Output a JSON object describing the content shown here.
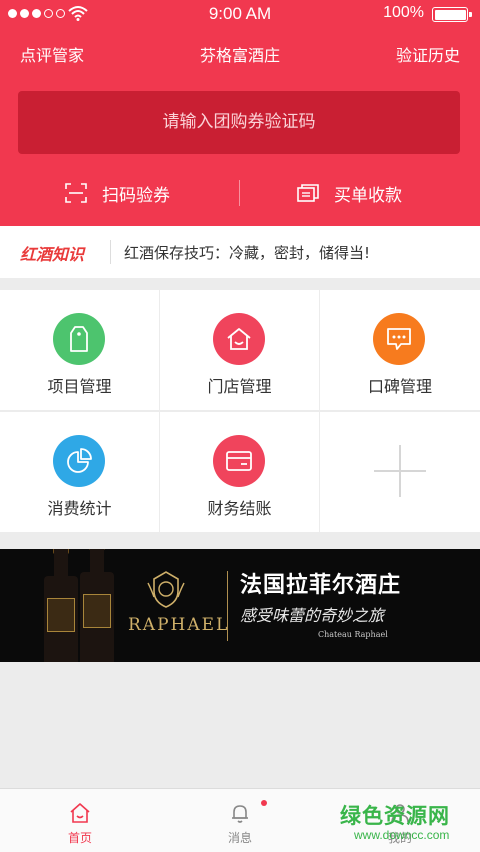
{
  "status_bar": {
    "time": "9:00 AM",
    "battery": "100%"
  },
  "nav": {
    "left": "点评管家",
    "title": "芬格富酒庄",
    "right": "验证历史"
  },
  "voucher_input": {
    "placeholder": "请输入团购券验证码"
  },
  "actions": {
    "scan": "扫码验券",
    "checkout": "买单收款"
  },
  "knowledge": {
    "label": "红酒知识",
    "text": "红酒保存技巧：冷藏，密封，储得当!"
  },
  "grid": {
    "items": [
      {
        "label": "项目管理",
        "color": "#4dc46e",
        "icon": "tag-icon"
      },
      {
        "label": "门店管理",
        "color": "#f0445c",
        "icon": "store-icon"
      },
      {
        "label": "口碑管理",
        "color": "#f77b1e",
        "icon": "chat-icon"
      },
      {
        "label": "消费统计",
        "color": "#2fa8e6",
        "icon": "pie-chart-icon"
      },
      {
        "label": "财务结账",
        "color": "#f0445c",
        "icon": "card-icon"
      }
    ]
  },
  "banner": {
    "brand": "RAPHAEL",
    "title": "法国拉菲尔酒庄",
    "subtitle": "感受味蕾的奇妙之旅",
    "small": "Chateau Raphael"
  },
  "tabbar": {
    "tabs": [
      {
        "label": "首页",
        "icon": "home-icon",
        "active": true
      },
      {
        "label": "消息",
        "icon": "bell-icon",
        "active": false
      },
      {
        "label": "我的",
        "icon": "user-icon",
        "active": false
      }
    ]
  },
  "watermark": {
    "name": "绿色资源网",
    "url": "www.downcc.com"
  },
  "colors": {
    "primary": "#f1384f",
    "input_bg": "#c91f33",
    "accent_green": "#39b54a"
  }
}
